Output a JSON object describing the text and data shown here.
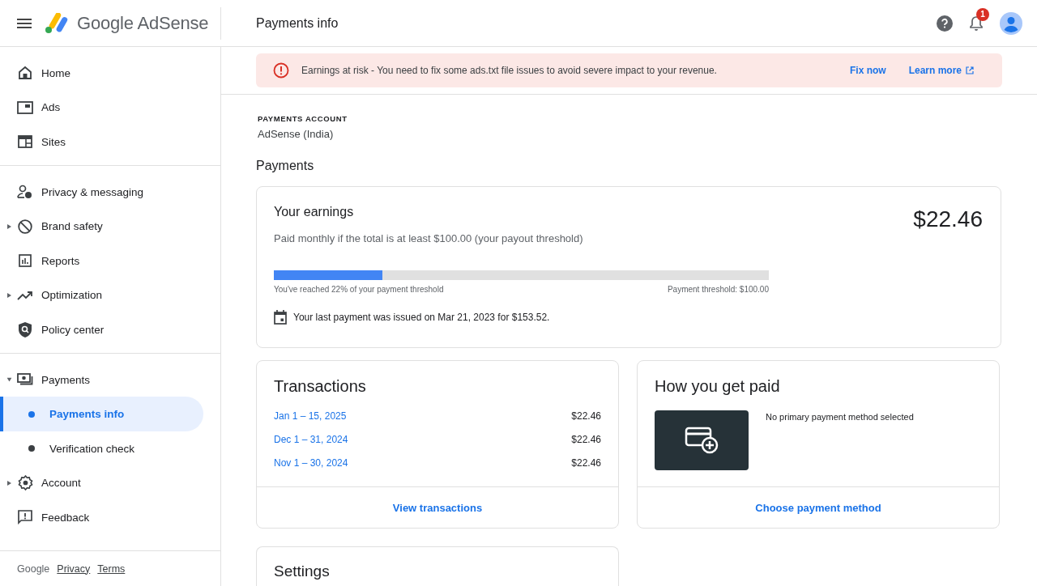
{
  "header": {
    "product": "Google AdSense",
    "page_title": "Payments info",
    "notification_count": "1"
  },
  "banner": {
    "message": "Earnings at risk - You need to fix some ads.txt file issues to avoid severe impact to your revenue.",
    "fix": "Fix now",
    "learn": "Learn more"
  },
  "sidebar": {
    "groups": [
      [
        {
          "label": "Home"
        },
        {
          "label": "Ads"
        },
        {
          "label": "Sites"
        }
      ],
      [
        {
          "label": "Privacy & messaging"
        },
        {
          "label": "Brand safety",
          "expanded": false
        },
        {
          "label": "Reports"
        },
        {
          "label": "Optimization",
          "expanded": false
        },
        {
          "label": "Policy center"
        }
      ],
      [
        {
          "label": "Payments",
          "expanded": true,
          "children": [
            {
              "label": "Payments info",
              "selected": true
            },
            {
              "label": "Verification check",
              "selected": false
            }
          ]
        },
        {
          "label": "Account",
          "expanded": false
        },
        {
          "label": "Feedback"
        }
      ]
    ],
    "footer": {
      "brand": "Google",
      "links": [
        "Privacy",
        "Terms"
      ]
    }
  },
  "account": {
    "label": "PAYMENTS ACCOUNT",
    "value": "AdSense (India)"
  },
  "section_title": "Payments",
  "earnings": {
    "title": "Your earnings",
    "amount": "$22.46",
    "note": "Paid monthly if the total is at least $100.00 (your payout threshold)",
    "level": 0.22,
    "reached": "You've reached 22% of your payment threshold",
    "threshold": "Payment threshold: $100.00",
    "last_payment": "Your last payment was issued on Mar 21, 2023 for $153.52."
  },
  "transactions": {
    "title": "Transactions",
    "rows": [
      {
        "period": "Jan 1 – 15, 2025",
        "amount": "$22.46"
      },
      {
        "period": "Dec 1 – 31, 2024",
        "amount": "$22.46"
      },
      {
        "period": "Nov 1 – 30, 2024",
        "amount": "$22.46"
      }
    ],
    "link": "View transactions"
  },
  "how_paid": {
    "title": "How you get paid",
    "status": "No primary payment method selected",
    "link": "Choose payment method"
  },
  "settings": {
    "title": "Settings"
  }
}
